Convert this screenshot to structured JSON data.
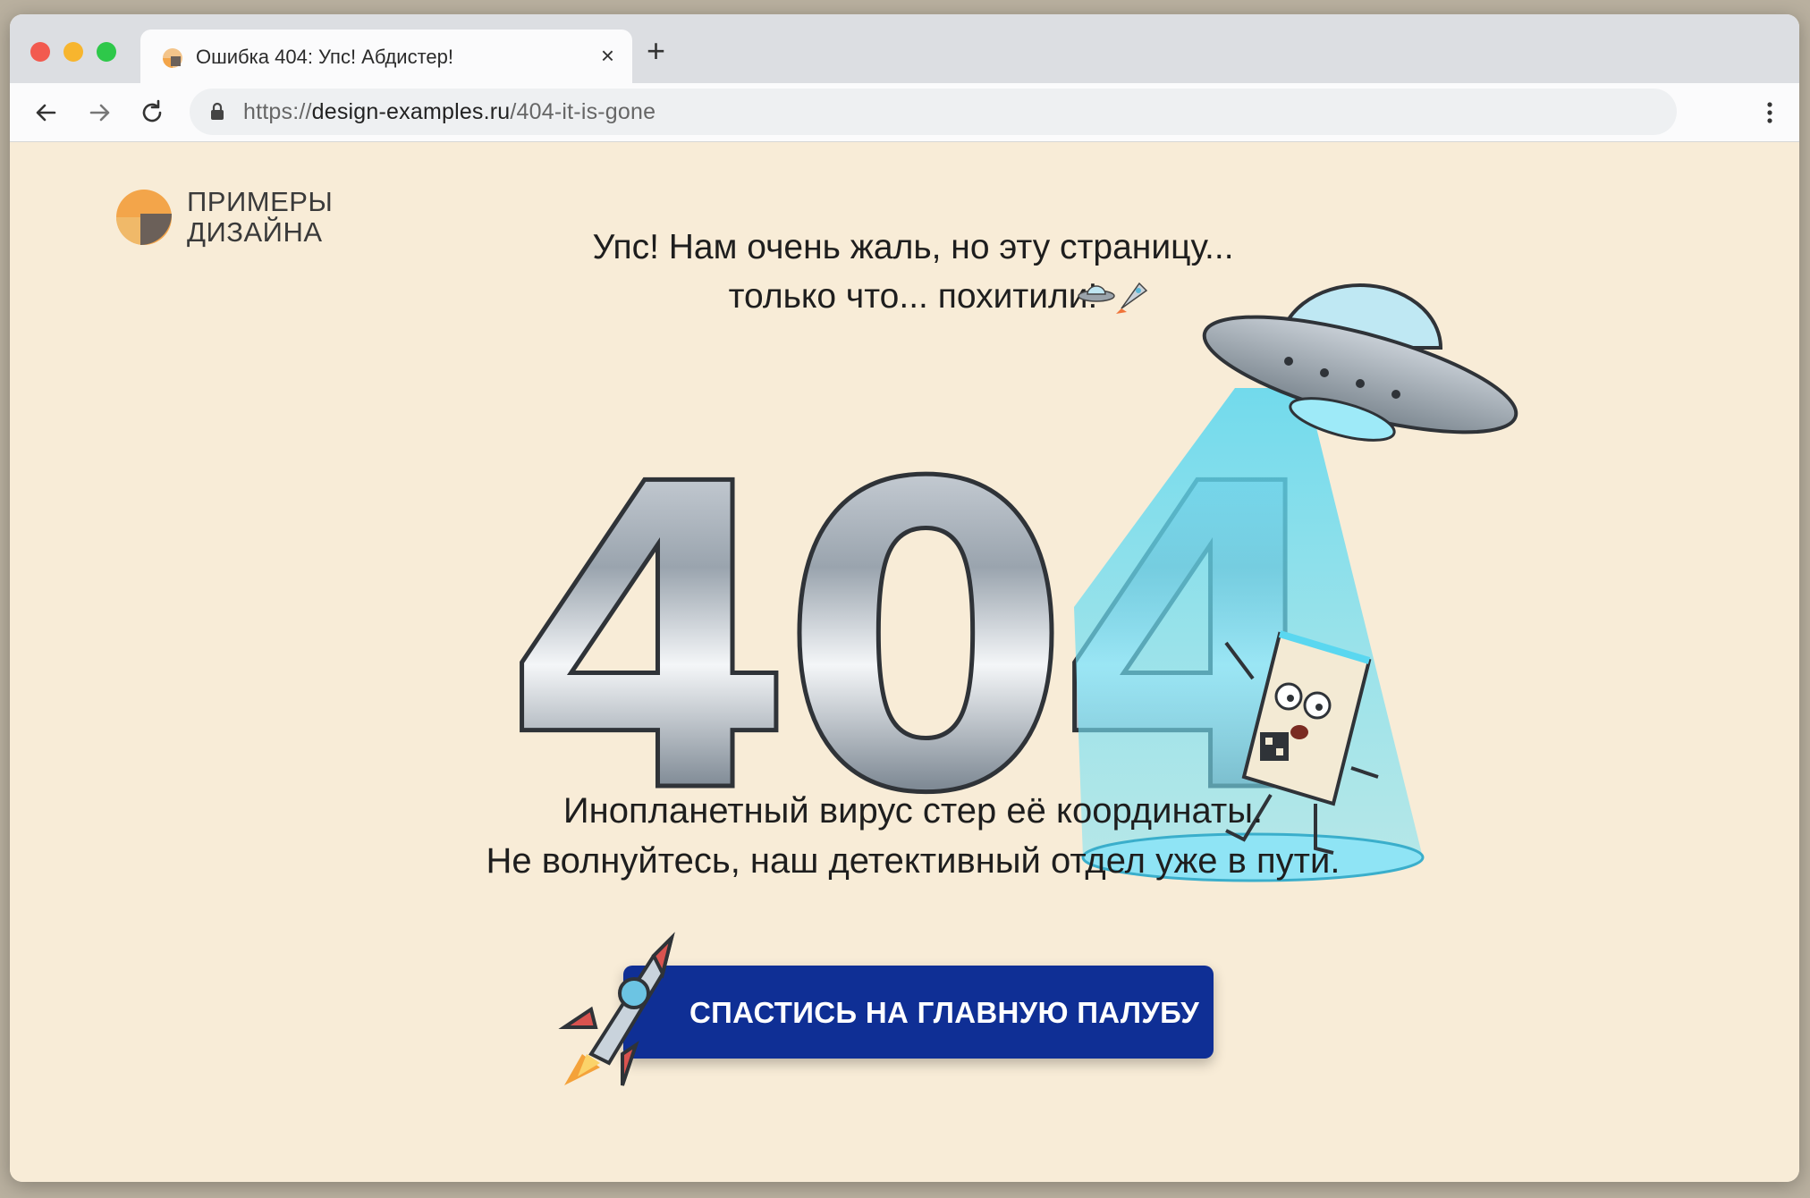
{
  "browser": {
    "tab": {
      "title": "Ошибка 404: Упс! Абдистер!",
      "close_icon": "close-icon"
    },
    "new_tab_icon": "plus-icon",
    "nav": {
      "back_icon": "arrow-left-icon",
      "forward_icon": "arrow-right-icon",
      "reload_icon": "reload-icon"
    },
    "address": {
      "scheme": "https://",
      "host": "design-examples.ru",
      "path": "/404-it-is-gone",
      "lock_icon": "lock-icon"
    },
    "menu_icon": "vertical-dots-icon"
  },
  "page": {
    "logo": {
      "line1": "ПРИМЕРЫ",
      "line2": "ДИЗАЙНА"
    },
    "headline": {
      "line1": "Упс! Нам очень жаль, но эту страницу...",
      "line2": "только что... похитили!"
    },
    "error_code": "404",
    "message": {
      "line1": "Инопланетный вирус стер её координаты.",
      "line2": "Не волнуйтесь, наш детективный отдел уже в пути."
    },
    "cta": {
      "label": "СПАСТИСЬ НА ГЛАВНУЮ ПАЛУБУ"
    }
  },
  "colors": {
    "page_background": "#f8ecd7",
    "cta_background": "#0f2f95",
    "cta_text": "#ffffff",
    "beam": "#5ad7f0",
    "logo_orange": "#f3a54a",
    "logo_dark": "#6b6059"
  }
}
